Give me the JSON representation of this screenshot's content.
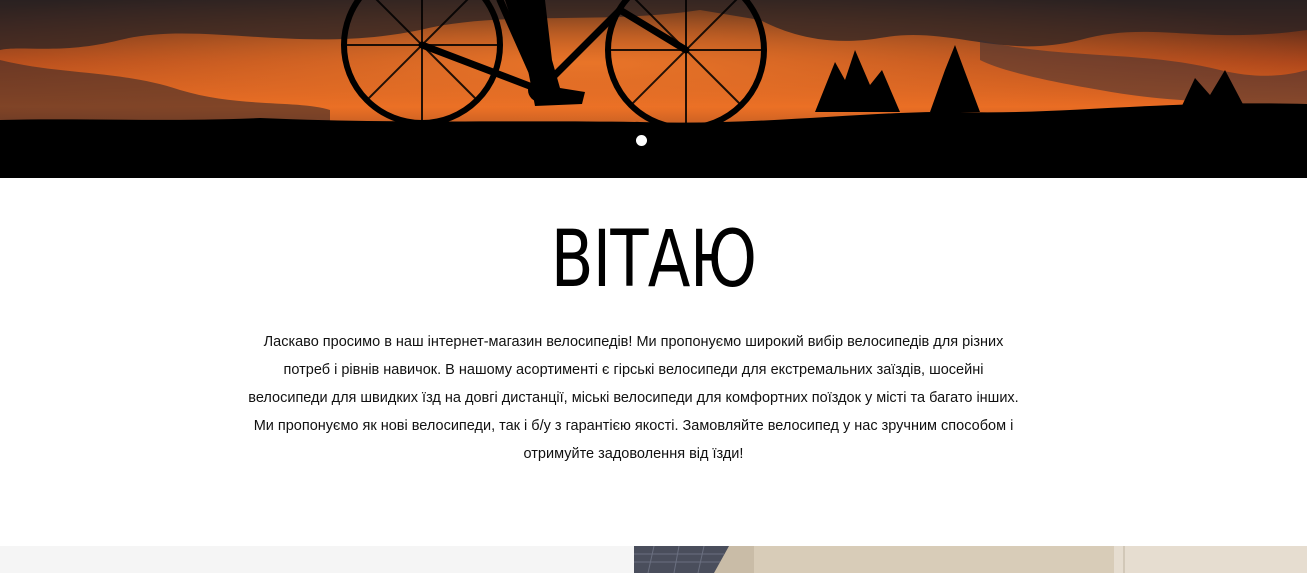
{
  "hero": {
    "slider_dots": 1,
    "active_slide": 1,
    "colors": {
      "sky_top": "#1b1b1b",
      "sky_orange": "#e0611f",
      "ground": "#000000"
    }
  },
  "welcome": {
    "title": "ВІТАЮ",
    "text": "Ласкаво просимо в наш інтернет-магазин велосипедів! Ми пропонуємо широкий вибір велосипедів для різних потреб і рівнів навичок. В нашому асортименті є гірські велосипеди для екстремальних заїздів, шосейні велосипеди для швидких їзд на довгі дистанції, міські велосипеди для комфортних поїздок у місті та багато інших. Ми пропонуємо як нові велосипеди, так і б/у з гарантією якості. Замовляйте велосипед у нас зручним способом і отримуйте задоволення від їзди!"
  },
  "colors": {
    "bottom_left_bg": "#f5f5f5",
    "bottom_right_bg": "#c7b8a2"
  }
}
